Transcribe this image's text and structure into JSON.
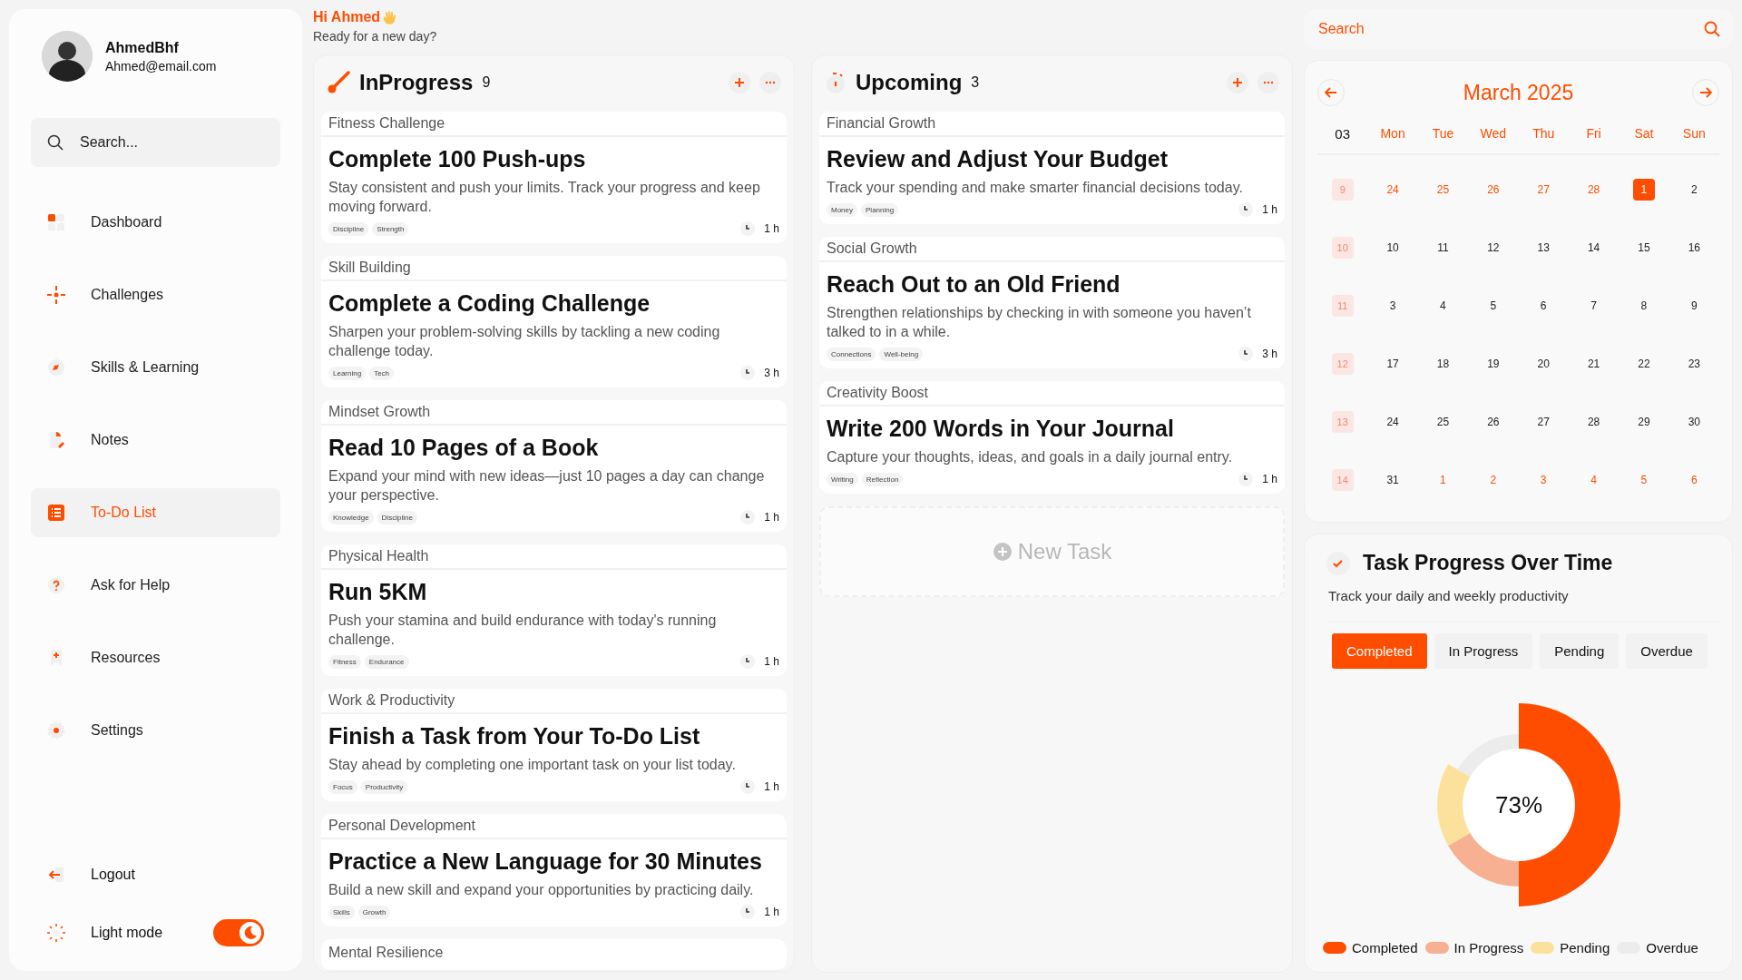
{
  "user": {
    "name": "AhmedBhf",
    "email": "Ahmed@email.com"
  },
  "sidebar": {
    "search": {
      "placeholder": "Search..."
    },
    "items": [
      {
        "label": "Dashboard",
        "selected": false
      },
      {
        "label": "Challenges",
        "selected": false
      },
      {
        "label": "Skills & Learning",
        "selected": false
      },
      {
        "label": "Notes",
        "selected": false
      },
      {
        "label": "To-Do List",
        "selected": true
      },
      {
        "label": "Ask for Help",
        "selected": false
      },
      {
        "label": "Resources",
        "selected": false
      },
      {
        "label": "Settings",
        "selected": false
      }
    ],
    "logout": "Logout",
    "theme": {
      "label": "Light mode",
      "on": true
    }
  },
  "greeting": {
    "title": "Hi Ahmed",
    "subtitle": "Ready for a new day?"
  },
  "columns": [
    {
      "title": "InProgress",
      "count": "9",
      "cards": [
        {
          "category": "Fitness Challenge",
          "title": "Complete 100 Push-ups",
          "description": "Stay consistent and push your limits. Track your progress and keep moving forward.",
          "tags": [
            "Discipline",
            "Strength"
          ],
          "time": "1 h"
        },
        {
          "category": "Skill Building",
          "title": "Complete a Coding Challenge",
          "description": "Sharpen your problem-solving skills by tackling a new coding challenge today.",
          "tags": [
            "Learning",
            "Tech"
          ],
          "time": "3 h"
        },
        {
          "category": "Mindset Growth",
          "title": "Read 10 Pages of a Book",
          "description": "Expand your mind with new ideas—just 10 pages a day can change your perspective.",
          "tags": [
            "Knowledge",
            "Discipline"
          ],
          "time": "1 h"
        },
        {
          "category": "Physical Health",
          "title": "Run 5KM",
          "description": "Push your stamina and build endurance with today's running challenge.",
          "tags": [
            "Fitness",
            "Endurance"
          ],
          "time": "1 h"
        },
        {
          "category": "Work & Productivity",
          "title": "Finish a Task from Your To-Do List",
          "description": "Stay ahead by completing one important task on your list today.",
          "tags": [
            "Focus",
            "Productivity"
          ],
          "time": "1 h"
        },
        {
          "category": "Personal Development",
          "title": "Practice a New Language for 30 Minutes",
          "description": "Build a new skill and expand your opportunities by practicing daily.",
          "tags": [
            "Skills",
            "Growth"
          ],
          "time": "1 h"
        },
        {
          "category": "Mental Resilience"
        }
      ]
    },
    {
      "title": "Upcoming",
      "count": "3",
      "cards": [
        {
          "category": "Financial Growth",
          "title": "Review and Adjust Your Budget",
          "description": "Track your spending and make smarter financial decisions today.",
          "tags": [
            "Money",
            "Planning"
          ],
          "time": "1 h"
        },
        {
          "category": "Social Growth",
          "title": "Reach Out to an Old Friend",
          "description": "Strengthen relationships by checking in with someone you haven’t talked to in a while.",
          "tags": [
            "Connections",
            "Well-being"
          ],
          "time": "3 h"
        },
        {
          "category": "Creativity Boost",
          "title": "Write 200 Words in Your Journal",
          "description": "Capture your thoughts, ideas, and goals in a daily journal entry.",
          "tags": [
            "Writing",
            "Reflection"
          ],
          "time": "1 h"
        }
      ],
      "new_task": "New Task"
    }
  ],
  "search": {
    "placeholder": "Search"
  },
  "calendar": {
    "title": "March 2025",
    "week_label": "03",
    "weekdays": [
      "Mon",
      "Tue",
      "Wed",
      "Thu",
      "Fri",
      "Sat",
      "Sun"
    ],
    "weeks": [
      {
        "week": "9",
        "days": [
          {
            "day": "24",
            "outside": true,
            "selected": false
          },
          {
            "day": "25",
            "outside": true,
            "selected": false
          },
          {
            "day": "26",
            "outside": true,
            "selected": false
          },
          {
            "day": "27",
            "outside": true,
            "selected": false
          },
          {
            "day": "28",
            "outside": true,
            "selected": false
          },
          {
            "day": "1",
            "outside": false,
            "selected": true
          },
          {
            "day": "2",
            "outside": false,
            "selected": false
          }
        ]
      },
      {
        "week": "10",
        "days": [
          {
            "day": "10",
            "outside": false,
            "selected": false
          },
          {
            "day": "11",
            "outside": false,
            "selected": false
          },
          {
            "day": "12",
            "outside": false,
            "selected": false
          },
          {
            "day": "13",
            "outside": false,
            "selected": false
          },
          {
            "day": "14",
            "outside": false,
            "selected": false
          },
          {
            "day": "15",
            "outside": false,
            "selected": false
          },
          {
            "day": "16",
            "outside": false,
            "selected": false
          }
        ]
      },
      {
        "week": "11",
        "days": [
          {
            "day": "3",
            "outside": false,
            "selected": false
          },
          {
            "day": "4",
            "outside": false,
            "selected": false
          },
          {
            "day": "5",
            "outside": false,
            "selected": false
          },
          {
            "day": "6",
            "outside": false,
            "selected": false
          },
          {
            "day": "7",
            "outside": false,
            "selected": false
          },
          {
            "day": "8",
            "outside": false,
            "selected": false
          },
          {
            "day": "9",
            "outside": false,
            "selected": false
          }
        ]
      },
      {
        "week": "12",
        "days": [
          {
            "day": "17",
            "outside": false,
            "selected": false
          },
          {
            "day": "18",
            "outside": false,
            "selected": false
          },
          {
            "day": "19",
            "outside": false,
            "selected": false
          },
          {
            "day": "20",
            "outside": false,
            "selected": false
          },
          {
            "day": "21",
            "outside": false,
            "selected": false
          },
          {
            "day": "22",
            "outside": false,
            "selected": false
          },
          {
            "day": "23",
            "outside": false,
            "selected": false
          }
        ]
      },
      {
        "week": "13",
        "days": [
          {
            "day": "24",
            "outside": false,
            "selected": false
          },
          {
            "day": "25",
            "outside": false,
            "selected": false
          },
          {
            "day": "26",
            "outside": false,
            "selected": false
          },
          {
            "day": "27",
            "outside": false,
            "selected": false
          },
          {
            "day": "28",
            "outside": false,
            "selected": false
          },
          {
            "day": "29",
            "outside": false,
            "selected": false
          },
          {
            "day": "30",
            "outside": false,
            "selected": false
          }
        ]
      },
      {
        "week": "14",
        "days": [
          {
            "day": "31",
            "outside": false,
            "selected": false
          },
          {
            "day": "1",
            "outside": true,
            "selected": false
          },
          {
            "day": "2",
            "outside": true,
            "selected": false
          },
          {
            "day": "3",
            "outside": true,
            "selected": false
          },
          {
            "day": "4",
            "outside": true,
            "selected": false
          },
          {
            "day": "5",
            "outside": true,
            "selected": false
          },
          {
            "day": "6",
            "outside": true,
            "selected": false
          }
        ]
      }
    ]
  },
  "progress": {
    "title": "Task Progress Over Time",
    "subtitle": "Track your daily and weekly productivity",
    "tabs": [
      {
        "label": "Completed",
        "selected": true
      },
      {
        "label": "In Progress",
        "selected": false
      },
      {
        "label": "Pending",
        "selected": false
      },
      {
        "label": "Overdue",
        "selected": false
      }
    ],
    "center_label": "73%",
    "legend": [
      {
        "label": "Completed",
        "color": "#ff4d00"
      },
      {
        "label": "In Progress",
        "color": "#f7b192"
      },
      {
        "label": "Pending",
        "color": "#fce19c"
      },
      {
        "label": "Overdue",
        "color": "#ececec"
      }
    ]
  }
}
